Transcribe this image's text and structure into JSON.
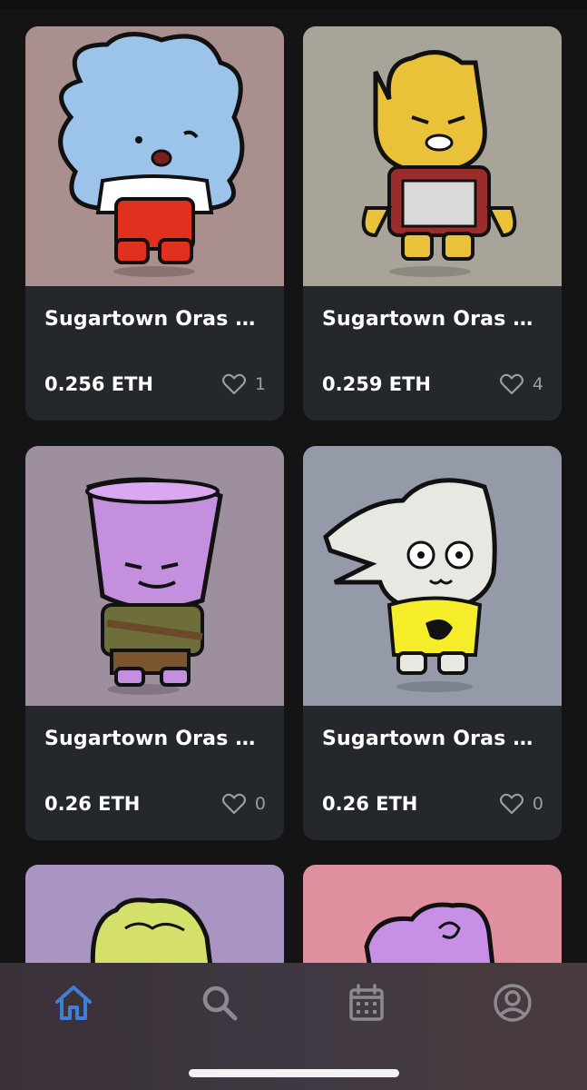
{
  "cards": [
    {
      "title": "Sugartown Oras #...",
      "price": "0.256 ETH",
      "likes": "1",
      "bg": "#a98f8e"
    },
    {
      "title": "Sugartown Oras #...",
      "price": "0.259 ETH",
      "likes": "4",
      "bg": "#a8a49a"
    },
    {
      "title": "Sugartown Oras #...",
      "price": "0.26 ETH",
      "likes": "0",
      "bg": "#9e8f9e"
    },
    {
      "title": "Sugartown Oras #...",
      "price": "0.26 ETH",
      "likes": "0",
      "bg": "#959aa8"
    },
    {
      "bg": "#a994c4"
    },
    {
      "bg": "#e08f9f"
    }
  ],
  "tabbar": {
    "items": [
      {
        "icon": "home-icon",
        "active": true
      },
      {
        "icon": "search-icon",
        "active": false
      },
      {
        "icon": "calendar-icon",
        "active": false
      },
      {
        "icon": "account-icon",
        "active": false
      }
    ],
    "active_color": "#3f7fd8",
    "inactive_color": "#8c8a90"
  }
}
